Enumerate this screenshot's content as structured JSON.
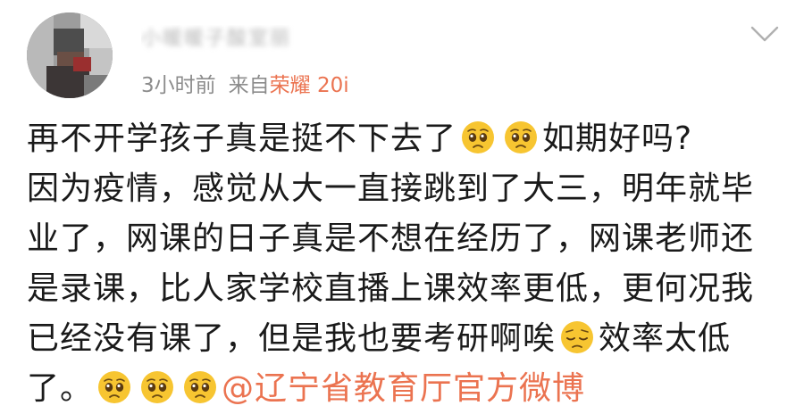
{
  "user": {
    "name_blurred": "小暖暖子酸室丽"
  },
  "meta": {
    "time": "3小时前",
    "source_prefix": "来自",
    "device": "荣耀 20i"
  },
  "icons": {
    "menu": "chevron-down-icon",
    "emoji_pleading": "pleading-face-emoji",
    "emoji_pensive": "pensive-face-emoji"
  },
  "colors": {
    "link": "#eb7350",
    "meta": "#8c8c8c",
    "text": "#1a1a1a"
  },
  "content": {
    "line1_a": "再不开学孩子真是挺不下去了",
    "line1_b": "如期好吗?",
    "line2": "因为疫情，感觉从大一直接跳到了大三，明年就毕",
    "line3": "业了，网课的日子真是不想在经历了，网课老师还",
    "line4": "是录课，比人家学校直播上课效率更低，更何况我",
    "line5_a": "已经没有课了，但是我也要考研啊唉",
    "line5_b": "效率太低",
    "line6_a": "了。",
    "mention": "@辽宁省教育厅官方微博"
  }
}
